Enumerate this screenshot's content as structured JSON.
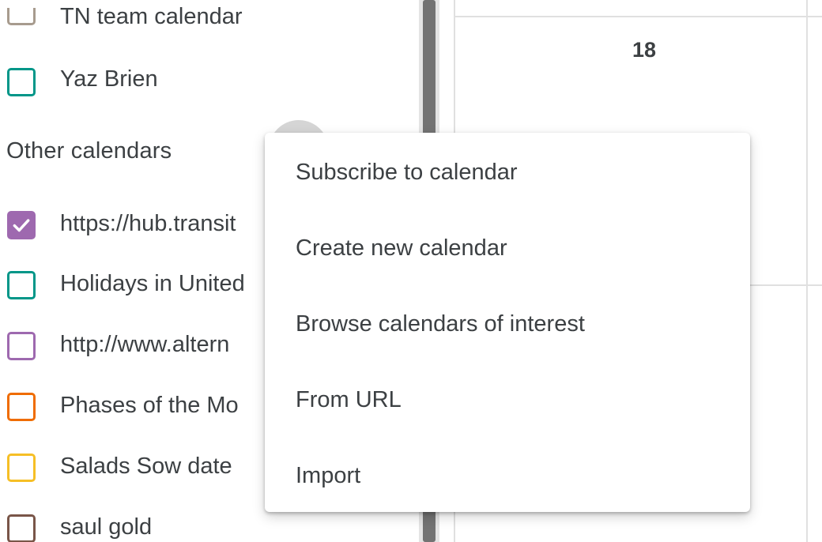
{
  "sidebar": {
    "my_calendars": [
      {
        "label": "TN team calendar",
        "color": "#a79b8e",
        "checked": false
      },
      {
        "label": "Yaz Brien",
        "color": "#009688",
        "checked": false
      }
    ],
    "other_calendars_heading": "Other calendars",
    "other_calendars": [
      {
        "label": "https://hub.transit",
        "color": "#9e69af",
        "checked": true
      },
      {
        "label": "Holidays in United",
        "color": "#009688",
        "checked": false
      },
      {
        "label": "http://www.altern",
        "color": "#9e69af",
        "checked": false
      },
      {
        "label": "Phases of the Mo",
        "color": "#ef6c00",
        "checked": false
      },
      {
        "label": "Salads Sow date",
        "color": "#f6bf26",
        "checked": false
      },
      {
        "label": "saul gold",
        "color": "#795548",
        "checked": false
      }
    ]
  },
  "calendar_grid": {
    "day_number": "18"
  },
  "menu": {
    "items": [
      {
        "label": "Subscribe to calendar"
      },
      {
        "label": "Create new calendar"
      },
      {
        "label": "Browse calendars of interest"
      },
      {
        "label": "From URL"
      },
      {
        "label": "Import"
      }
    ]
  },
  "colors": {
    "checkbox_check": "#ffffff",
    "scrollbar_thumb": "#737373",
    "grid_line": "#e0e0e0"
  }
}
